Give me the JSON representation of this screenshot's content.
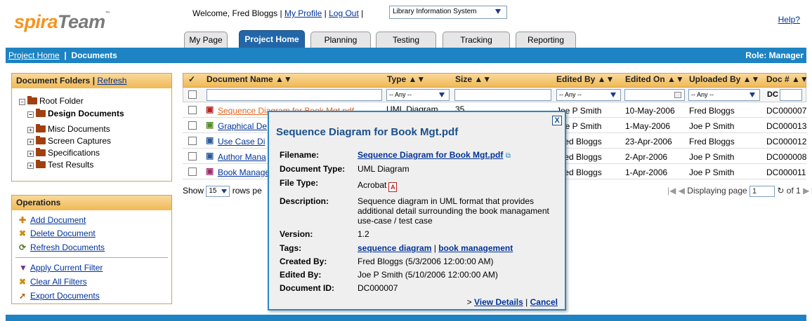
{
  "header": {
    "logo_spira": "spira",
    "logo_team": "Team",
    "logo_tm": "™",
    "welcome_text": "Welcome, Fred Bloggs",
    "my_profile": "My Profile",
    "log_out": "Log Out",
    "project_selected": "Library Information System",
    "help": "Help?"
  },
  "tabs": [
    "My Page",
    "Project Home",
    "Planning",
    "Testing",
    "Tracking",
    "Reporting"
  ],
  "breadcrumb": {
    "home": "Project Home",
    "separator": "|",
    "current": "Documents"
  },
  "role": "Role: Manager",
  "folders_panel": {
    "title": "Document Folders",
    "separator": "|",
    "refresh": "Refresh",
    "root": "Root Folder",
    "items": [
      "Design Documents",
      "Misc Documents",
      "Screen Captures",
      "Specifications",
      "Test Results"
    ]
  },
  "operations_panel": {
    "title": "Operations",
    "items": [
      "Add Document",
      "Delete Document",
      "Refresh Documents",
      "Apply Current Filter",
      "Clear All Filters",
      "Export Documents"
    ]
  },
  "grid": {
    "check_header": "✓",
    "columns": [
      "Document Name ▲▼",
      "Type ▲▼",
      "Size ▲▼",
      "Edited By ▲▼",
      "Edited On ▲▼",
      "Uploaded By ▲▼",
      "Doc # ▲▼"
    ],
    "filters": {
      "type": "-- Any --",
      "edited_by": "-- Any --",
      "uploaded_by": "-- Any --",
      "doc_prefix": "DC"
    },
    "rows": [
      {
        "name": "Sequence Diagram for Book Mgt.pdf",
        "type": "UML Diagram",
        "size": "35",
        "edited_by": "Joe P Smith",
        "edited_on": "10-May-2006",
        "uploaded_by": "Fred Bloggs",
        "doc_no": "DC000007"
      },
      {
        "name": "Graphical De",
        "edited_by": "Joe P Smith",
        "edited_on": "1-May-2006",
        "uploaded_by": "Joe P Smith",
        "doc_no": "DC000013"
      },
      {
        "name": "Use Case Di",
        "edited_by": "Fred Bloggs",
        "edited_on": "23-Apr-2006",
        "uploaded_by": "Fred Bloggs",
        "doc_no": "DC000012"
      },
      {
        "name": "Author Mana",
        "edited_by": "Fred Bloggs",
        "edited_on": "2-Apr-2006",
        "uploaded_by": "Joe P Smith",
        "doc_no": "DC000008"
      },
      {
        "name": "Book Manage",
        "edited_by": "Fred Bloggs",
        "edited_on": "1-Apr-2006",
        "uploaded_by": "Joe P Smith",
        "doc_no": "DC000011"
      }
    ],
    "footer": {
      "show": "Show",
      "rows_per_page": "15",
      "rows_label": "rows pe",
      "displaying_page": "Displaying page",
      "page": "1",
      "of_pages": "of 1"
    }
  },
  "popup": {
    "title": "Sequence Diagram for Book Mgt.pdf",
    "close": "X",
    "filename_label": "Filename:",
    "filename": "Sequence Diagram for Book Mgt.pdf",
    "doc_type_label": "Document Type:",
    "doc_type": "UML Diagram",
    "file_type_label": "File Type:",
    "file_type": "Acrobat",
    "description_label": "Description:",
    "description": "Sequence diagram in UML format that provides additional detail surrounding the book managament use-case / test case",
    "version_label": "Version:",
    "version": "1.2",
    "tags_label": "Tags:",
    "tag1": "sequence diagram",
    "tag_sep": "|",
    "tag2": "book management",
    "created_by_label": "Created By:",
    "created_by": "Fred Bloggs (5/3/2006 12:00:00 AM)",
    "edited_by_label": "Edited By:",
    "edited_by": "Joe P Smith (5/10/2006 12:00:00 AM)",
    "doc_id_label": "Document ID:",
    "doc_id": "DC000007",
    "arrow": ">",
    "view_details": "View Details",
    "action_sep": "|",
    "cancel": "Cancel"
  },
  "icons": {
    "logo": "spirateam-logo",
    "folder": "folder-icon",
    "pdf": "pdf-icon"
  },
  "colors": {
    "brand_blue": "#1d83c2",
    "tab_active": "#2266a8",
    "panel_header": "#f0b955",
    "logo_orange": "#f7941d",
    "link": "#003399"
  }
}
